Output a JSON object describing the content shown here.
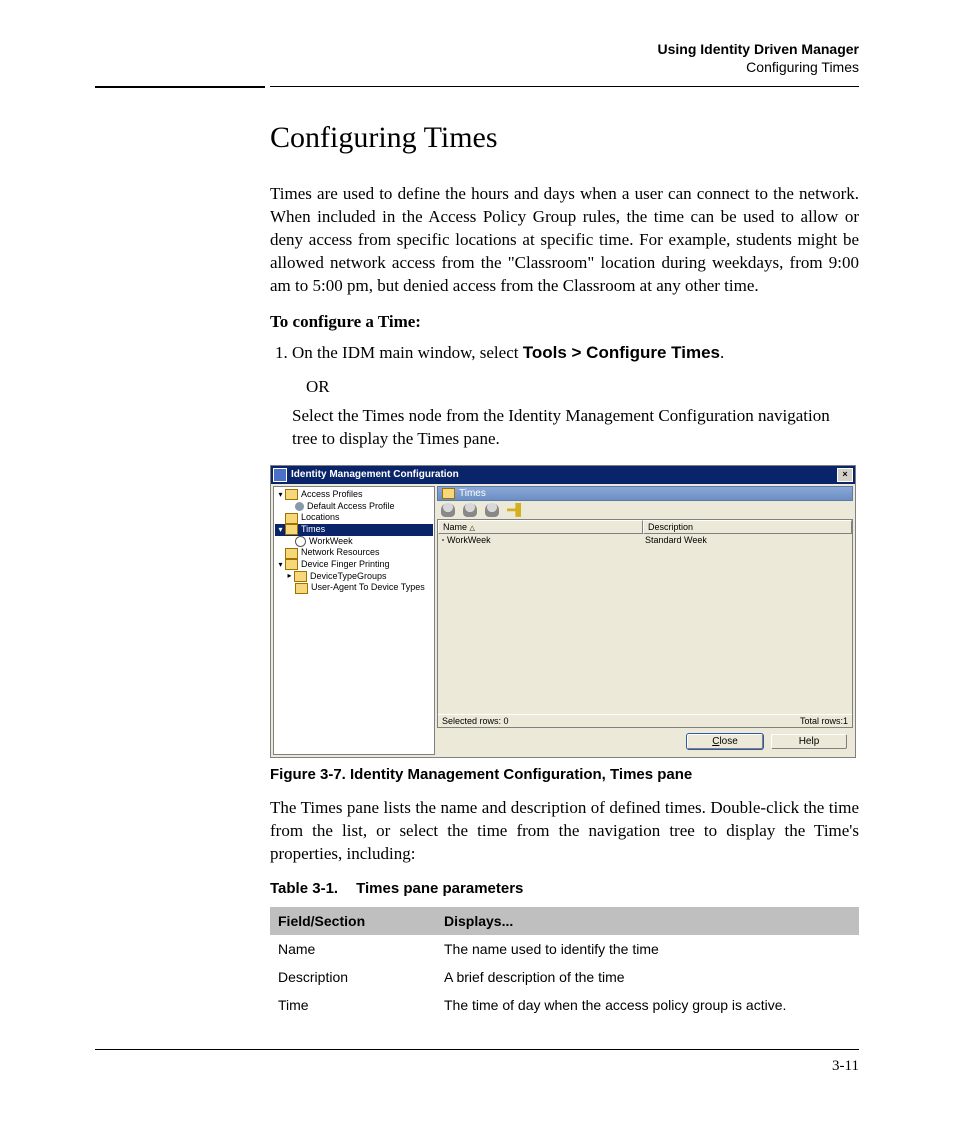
{
  "header": {
    "line1": "Using Identity Driven Manager",
    "line2": "Configuring Times"
  },
  "title": "Configuring Times",
  "intro": "Times are used to define the hours and days when a user can connect to the network. When included in the Access Policy Group rules, the time can be used to allow or deny access from specific locations at specific time. For example, students might be allowed network access from the \"Classroom\" location during weekdays, from 9:00 am to 5:00 pm, but denied access from the Classroom at any other time.",
  "procedure_head": "To configure a Time:",
  "step1_prefix": "On the IDM main window, select ",
  "step1_bold": "Tools > Configure Times",
  "step1_suffix": ".",
  "or_text": "OR",
  "step1_alt": "Select the Times node from the Identity Management Configuration navigation tree to display the Times pane.",
  "screenshot": {
    "window_title": "Identity Management Configuration",
    "tree": {
      "access_profiles": "Access Profiles",
      "default_access": "Default Access Profile",
      "locations": "Locations",
      "times": "Times",
      "workweek": "WorkWeek",
      "network_resources": "Network Resources",
      "device_fp": "Device Finger Printing",
      "device_type_groups": "DeviceTypeGroups",
      "user_agent": "User-Agent To Device Types"
    },
    "pane_title": "Times",
    "columns": {
      "name": "Name",
      "desc": "Description"
    },
    "rows": [
      {
        "name": "WorkWeek",
        "desc": "Standard Week"
      }
    ],
    "status_left": "Selected rows: 0",
    "status_right": "Total rows:1",
    "btn_close": "Close",
    "btn_help": "Help"
  },
  "figure_caption": "Figure 3-7. Identity Management Configuration, Times pane",
  "after_figure": "The Times pane lists the name and description of defined times. Double-click the time from the list, or select the time from the navigation tree to display the Time's properties, including:",
  "table_caption_num": "Table 3-1.",
  "table_caption_title": "Times pane parameters",
  "table": {
    "head_field": "Field/Section",
    "head_displays": "Displays...",
    "rows": [
      {
        "field": "Name",
        "displays": "The name used to identify the time"
      },
      {
        "field": "Description",
        "displays": "A brief description of the time"
      },
      {
        "field": "Time",
        "displays": "The time of day when the access policy group is active."
      }
    ]
  },
  "page_number": "3-11"
}
